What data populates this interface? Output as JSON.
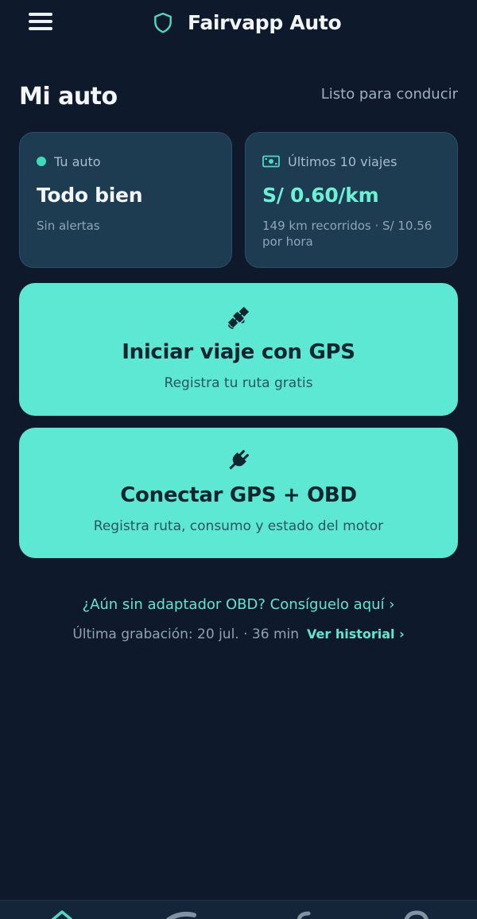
{
  "header": {
    "app_title": "Fairvapp Auto",
    "menu_icon": "hamburger-menu-icon",
    "logo_icon": "shield-icon"
  },
  "main": {
    "title": "Mi auto",
    "status": "Listo para conducir"
  },
  "cards": {
    "car": {
      "label": "Tu auto",
      "value": "Todo bien",
      "sub": "Sin alertas",
      "indicator_color": "#3fd9b4"
    },
    "trips": {
      "label": "Últimos 10 viajes",
      "value": "S/ 0.60/km",
      "sub": "149 km recorridos · S/ 10.56 por hora",
      "icon": "money-icon"
    }
  },
  "actions": {
    "gps": {
      "title": "Iniciar viaje con GPS",
      "sub": "Registra tu ruta gratis",
      "icon": "satellite-icon"
    },
    "obd": {
      "title": "Conectar GPS + OBD",
      "sub": "Registra ruta, consumo y estado del motor",
      "icon": "plug-icon"
    }
  },
  "footer": {
    "obd_link": "¿Aún sin adaptador OBD? Consíguelo aquí ›",
    "last_recording": "Última grabación: 20 jul. · 36 min",
    "history_link": "Ver historial ›"
  },
  "colors": {
    "background": "#0e1a2b",
    "card": "#1d3b51",
    "accent": "#5de8d4",
    "accent_text": "#5fe6d0"
  }
}
